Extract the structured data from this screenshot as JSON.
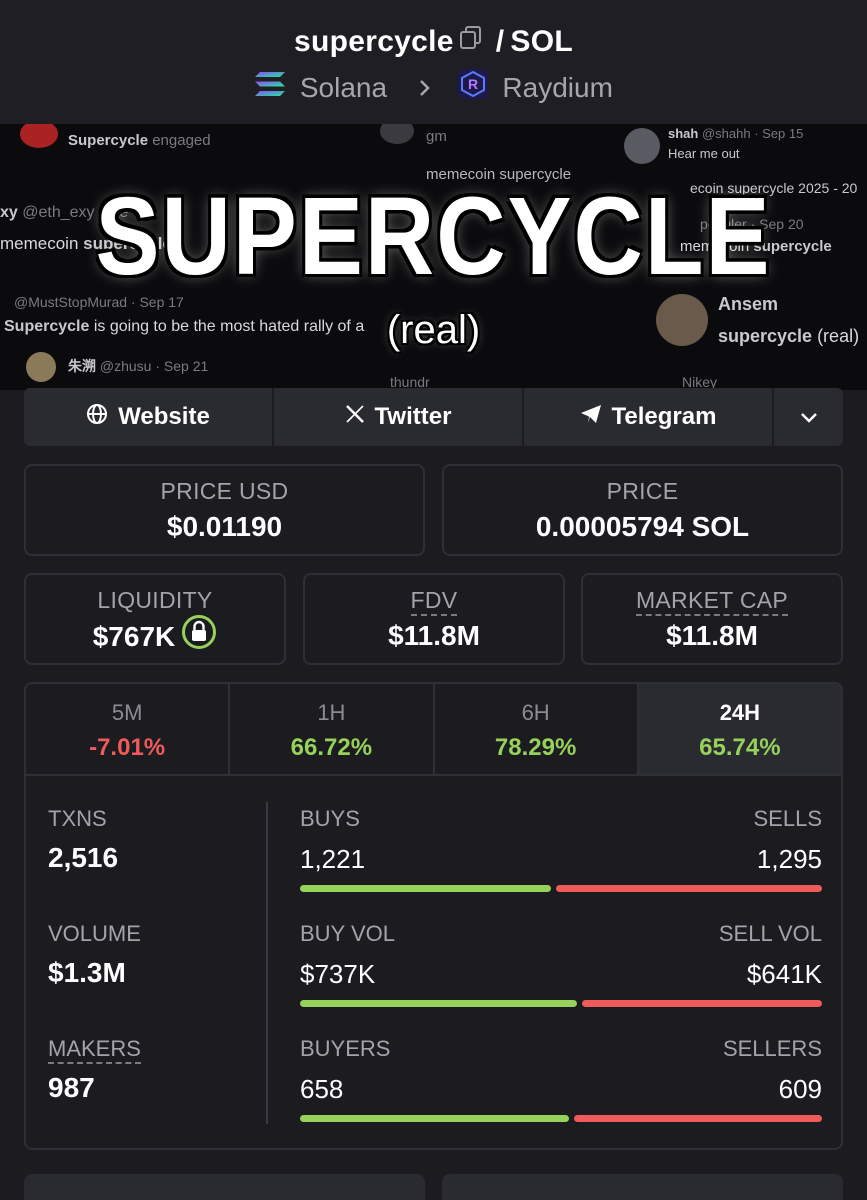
{
  "header": {
    "token": "supercycle",
    "separator": "/",
    "quote": "SOL",
    "chain": "Solana",
    "dex": "Raydium"
  },
  "banner": {
    "title": "SUPERCYCLE",
    "subtitle": "(real)",
    "bg_tweets": {
      "t1_name": "Supercycle",
      "t1_text": "engaged",
      "t2": "gm",
      "t3_name": "shah",
      "t3_handle": "@shahh · Sep 15",
      "t3_text": "Hear me out",
      "t4_bold": "memecoin supercycle",
      "t5": "ecoin supercycle 2025 - 20",
      "t6_name": "xy",
      "t6_handle": "@eth_exy · Se",
      "t7_pre": "memecoin ",
      "t7_bold": "supercycle",
      "t8": "peggler · Sep 20",
      "t9_pre": "memecoin ",
      "t9_bold": "supercycle",
      "t10": "@MustStopMurad · Sep 17",
      "t11_bold": "Supercycle",
      "t11_text": " is going to be the most hated rally of a",
      "t12": "Ansem",
      "t13_bold": "supercycle",
      "t13_text": " (real)",
      "t14_name": "朱溯",
      "t14_handle": "@zhusu · Sep 21",
      "t15": "thundr",
      "t16": "Nikey"
    }
  },
  "links": {
    "website": "Website",
    "twitter": "Twitter",
    "telegram": "Telegram"
  },
  "prices": {
    "usd_label": "PRICE USD",
    "usd_value": "$0.01190",
    "native_label": "PRICE",
    "native_value": "0.00005794 SOL"
  },
  "metrics": {
    "liquidity_label": "LIQUIDITY",
    "liquidity_value": "$767K",
    "fdv_label": "FDV",
    "fdv_value": "$11.8M",
    "mcap_label": "MARKET CAP",
    "mcap_value": "$11.8M"
  },
  "timeframes": [
    {
      "label": "5M",
      "change": "-7.01%"
    },
    {
      "label": "1H",
      "change": "66.72%"
    },
    {
      "label": "6H",
      "change": "78.29%"
    },
    {
      "label": "24H",
      "change": "65.74%"
    }
  ],
  "stats": {
    "txns_label": "TXNS",
    "txns_value": "2,516",
    "volume_label": "VOLUME",
    "volume_value": "$1.3M",
    "makers_label": "MAKERS",
    "makers_value": "987"
  },
  "split": {
    "buys_label": "BUYS",
    "buys_value": "1,221",
    "sells_label": "SELLS",
    "sells_value": "1,295",
    "buys_share": 0.485,
    "buyvol_label": "BUY VOL",
    "buyvol_value": "$737K",
    "sellvol_label": "SELL VOL",
    "sellvol_value": "$641K",
    "buyvol_share": 0.535,
    "buyers_label": "BUYERS",
    "buyers_value": "658",
    "sellers_label": "SELLERS",
    "sellers_value": "609",
    "buyers_share": 0.519
  },
  "colors": {
    "positive": "#96d15a",
    "negative": "#ef5a5a",
    "background": "#1b1b20"
  }
}
